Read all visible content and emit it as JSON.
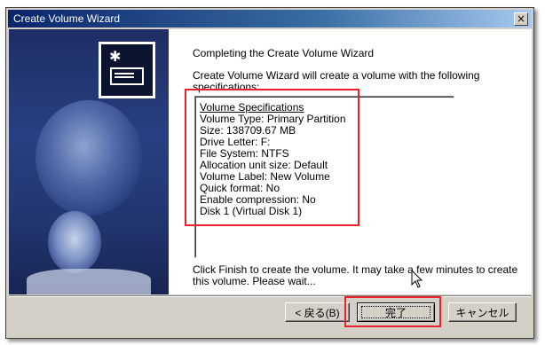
{
  "window": {
    "title": "Create Volume Wizard",
    "close_symbol": "×"
  },
  "left_panel": {
    "icon": "disk-drive-icon"
  },
  "content": {
    "heading": "Completing the Create Volume Wizard",
    "intro": "Create Volume Wizard will create a volume with the following specifications:",
    "specs": {
      "header": "Volume Specifications",
      "lines": [
        "Volume Type: Primary Partition",
        "Size: 138709.67 MB",
        "Drive Letter: F:",
        "File System: NTFS",
        "Allocation unit size: Default",
        "Volume Label: New Volume",
        "Quick format: No",
        "Enable compression: No",
        "Disk 1 (Virtual Disk 1)"
      ]
    },
    "finish_text": "Click Finish to create the volume. It may take a few minutes to create this volume. Please wait..."
  },
  "buttons": {
    "back": "< 戻る(B)",
    "finish": "完了",
    "cancel": "キャンセル"
  },
  "colors": {
    "highlight": "#e8212b",
    "titlebar": "#0a246a",
    "panel": "#293f83"
  }
}
